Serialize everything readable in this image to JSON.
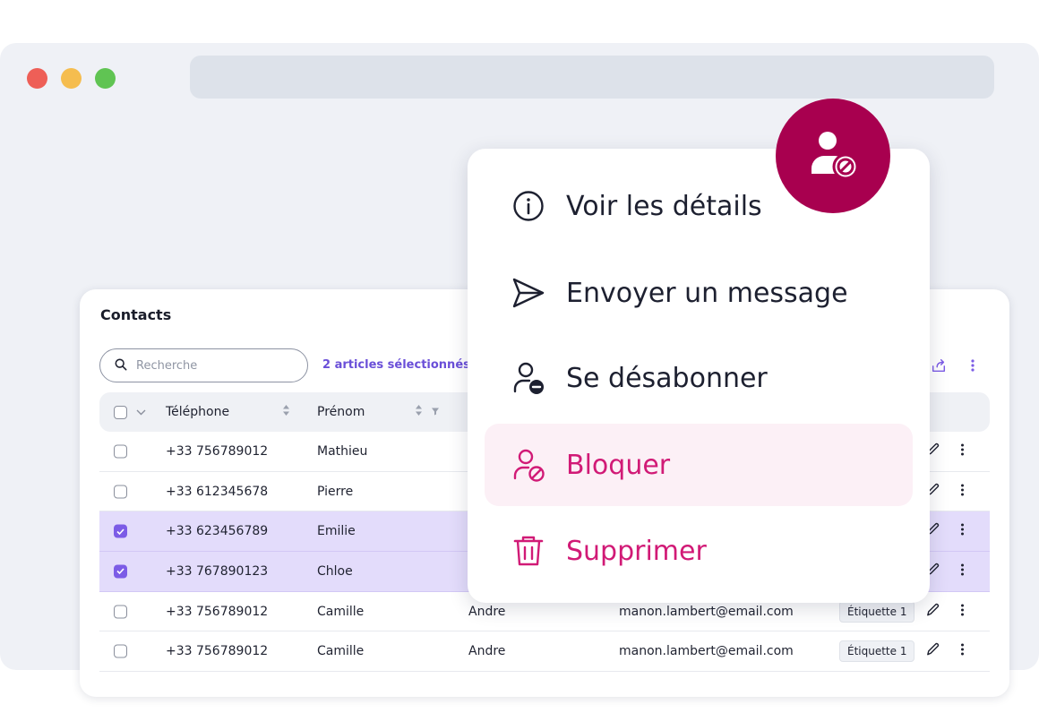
{
  "colors": {
    "accent": "#7c5ce6",
    "danger": "#d11a76",
    "badge": "#a8004f",
    "selected_row": "#e3dcfb"
  },
  "card": {
    "title": "Contacts",
    "search_placeholder": "Recherche",
    "selected_count": "2 articles sélectionnés"
  },
  "table": {
    "headers": {
      "phone": "Téléphone",
      "first_name": "Prénom"
    },
    "rows": [
      {
        "checked": false,
        "phone": "+33 756789012",
        "first_name": "Mathieu",
        "last_name": "",
        "email": "",
        "tag": ""
      },
      {
        "checked": false,
        "phone": "+33 612345678",
        "first_name": "Pierre",
        "last_name": "",
        "email": "",
        "tag": ""
      },
      {
        "checked": true,
        "phone": "+33 623456789",
        "first_name": "Emilie",
        "last_name": "",
        "email": "",
        "tag": ""
      },
      {
        "checked": true,
        "phone": "+33 767890123",
        "first_name": "Chloe",
        "last_name": "",
        "email": "",
        "tag": ""
      },
      {
        "checked": false,
        "phone": "+33 756789012",
        "first_name": "Camille",
        "last_name": "Andre",
        "email": "manon.lambert@email.com",
        "tag": "Étiquette 1"
      },
      {
        "checked": false,
        "phone": "+33 756789012",
        "first_name": "Camille",
        "last_name": "Andre",
        "email": "manon.lambert@email.com",
        "tag": "Étiquette 1"
      }
    ]
  },
  "menu": {
    "items": [
      {
        "label": "Voir les détails",
        "icon": "info-icon"
      },
      {
        "label": "Envoyer un message",
        "icon": "send-icon"
      },
      {
        "label": "Se désabonner",
        "icon": "user-minus-icon"
      },
      {
        "label": "Bloquer",
        "icon": "user-block-icon",
        "highlighted": true
      },
      {
        "label": "Supprimer",
        "icon": "trash-icon"
      }
    ]
  }
}
